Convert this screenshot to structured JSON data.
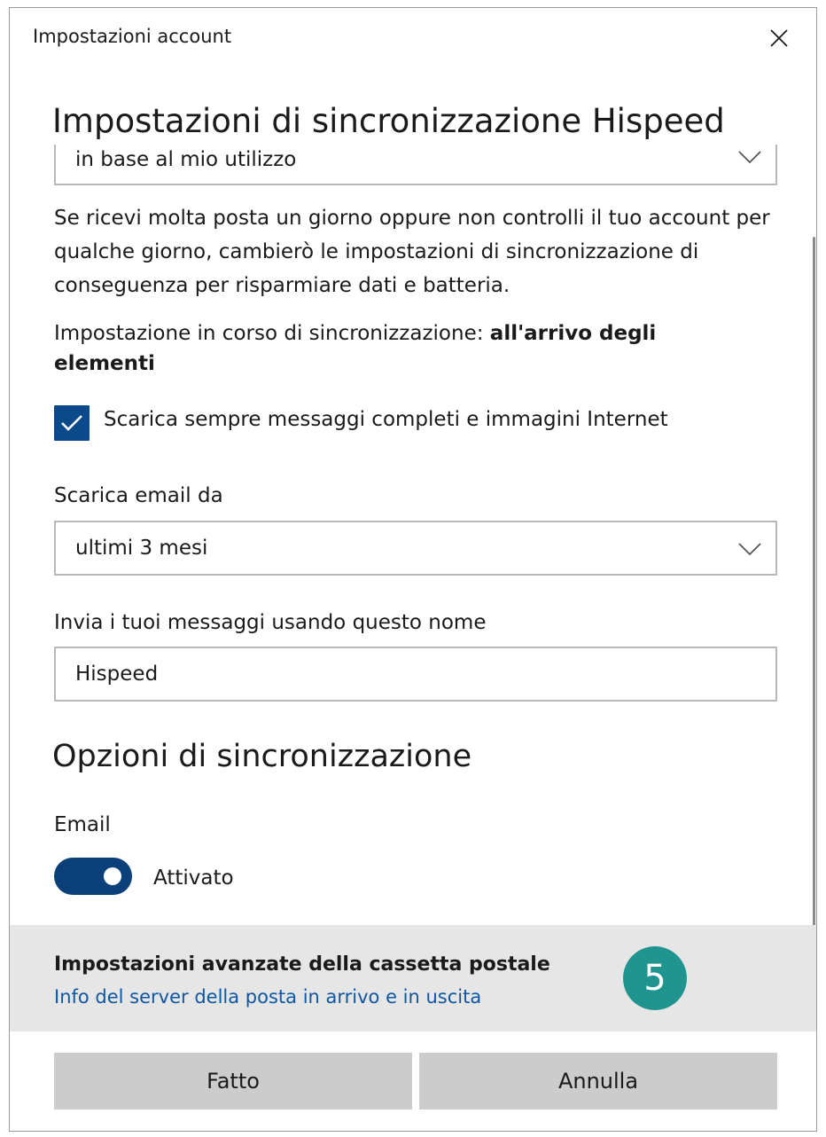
{
  "window": {
    "title": "Impostazioni account"
  },
  "sync_settings": {
    "heading": "Impostazioni di sincronizzazione Hispeed",
    "download_new_content_value": "in base al mio utilizzo",
    "description": "Se ricevi molta posta un giorno oppure non controlli il tuo account per qualche giorno, cambierò le impostazioni di sincronizzazione di conseguenza per risparmiare dati e batteria.",
    "current_setting_label": "Impostazione in corso di sincronizzazione: ",
    "current_setting_value": "all'arrivo degli elementi",
    "full_messages_checkbox_label": "Scarica sempre messaggi completi e immagini Internet",
    "full_messages_checked": true,
    "download_email_label": "Scarica email da",
    "download_email_value": "ultimi 3 mesi",
    "send_name_label": "Invia i tuoi messaggi usando questo nome",
    "send_name_value": "Hispeed"
  },
  "sync_options": {
    "heading": "Opzioni di sincronizzazione",
    "email_label": "Email",
    "email_toggle_state": "Attivato",
    "email_toggle_on": true
  },
  "advanced": {
    "title": "Impostazioni avanzate della cassetta postale",
    "link": "Info del server della posta in arrivo e in uscita",
    "badge": "5"
  },
  "buttons": {
    "done": "Fatto",
    "cancel": "Annulla"
  },
  "colors": {
    "accent": "#0a4a8a",
    "link": "#0f56a3",
    "badge": "#20958f"
  }
}
